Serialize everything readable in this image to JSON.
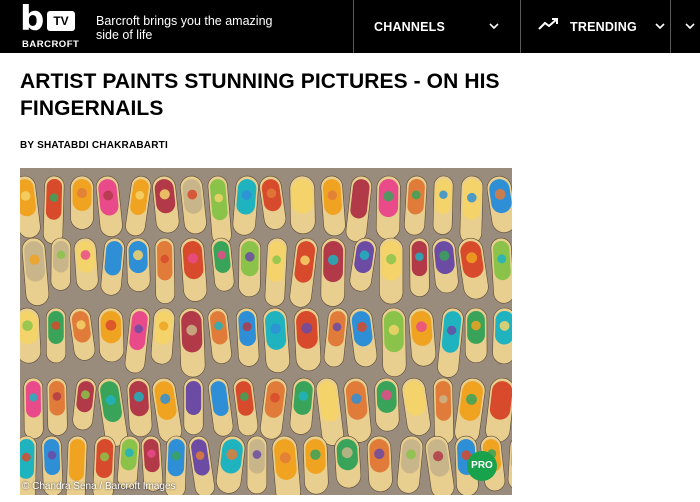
{
  "header": {
    "logo_letter": "b",
    "logo_badge": "TV",
    "logo_brand": "BARCROFT",
    "tagline": "Barcroft brings you the amazing side of life",
    "channels_label": "CHANNELS",
    "trending_label": "TRENDING",
    "icons": [
      "chevron-down-icon",
      "trending-up-icon",
      "chevron-down-icon",
      "chevron-down-icon"
    ]
  },
  "article": {
    "headline": "ARTIST PAINTS STUNNING PICTURES - ON HIS FINGERNAILS",
    "byline": "BY SHATABDI CHAKRABARTI",
    "image": {
      "description_icon": "painted-fingernails-photo",
      "credit": "© Chandra Sena / Barcroft Images",
      "badge": "PRO"
    }
  },
  "colors": {
    "header_bg": "#000000",
    "text": "#000000",
    "badge_green": "#19a24c"
  }
}
